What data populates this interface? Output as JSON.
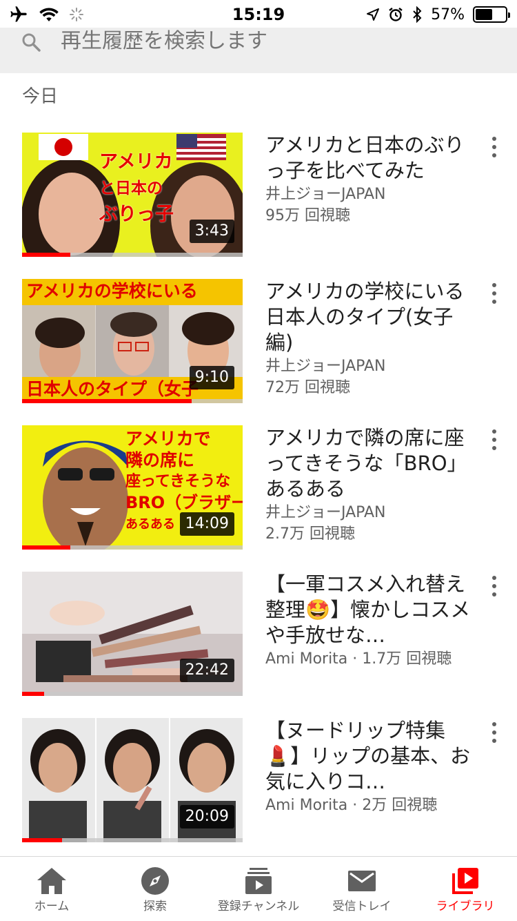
{
  "status_bar": {
    "time": "15:19",
    "battery": "57%",
    "battery_level": 0.57
  },
  "search": {
    "placeholder": "再生履歴を検索します"
  },
  "section": {
    "label": "今日"
  },
  "videos": [
    {
      "title": "アメリカと日本のぶりっ子を比べてみた",
      "channel": "井上ジョーJAPAN",
      "views": "95万 回視聴",
      "duration": "3:43",
      "progress": 0.22,
      "thumb_text": [
        "アメリカ",
        "と日本の",
        "ぶりっ子"
      ]
    },
    {
      "title": "アメリカの学校にいる日本人のタイプ(女子編)",
      "channel": "井上ジョーJAPAN",
      "views": "72万 回視聴",
      "duration": "9:10",
      "progress": 0.77,
      "thumb_text": [
        "アメリカの学校にいる",
        "日本人のタイプ（女子"
      ]
    },
    {
      "title": "アメリカで隣の席に座ってきそうな「BRO」あるある",
      "channel": "井上ジョーJAPAN",
      "views": "2.7万 回視聴",
      "duration": "14:09",
      "progress": 0.22,
      "thumb_text": [
        "アメリカで",
        "隣の席に",
        "座ってきそうな",
        "BRO（ブラザー）",
        "あるある"
      ]
    },
    {
      "title": "【一軍コスメ入れ替え整理🤩】懐かしコスメや手放せな…",
      "subline": "Ami Morita · 1.7万 回視聴",
      "duration": "22:42",
      "progress": 0.1
    },
    {
      "title": "【ヌードリップ特集💄】リップの基本、お気に入りコ…",
      "subline": "Ami Morita · 2万 回視聴",
      "duration": "20:09",
      "progress": 0.18
    }
  ],
  "bottom_nav": [
    {
      "label": "ホーム",
      "icon": "home-icon"
    },
    {
      "label": "探索",
      "icon": "compass-icon"
    },
    {
      "label": "登録チャンネル",
      "icon": "subscriptions-icon"
    },
    {
      "label": "受信トレイ",
      "icon": "inbox-icon"
    },
    {
      "label": "ライブラリ",
      "icon": "library-icon",
      "active": true
    }
  ],
  "colors": {
    "accent": "#ff0000",
    "text_primary": "#202020",
    "text_secondary": "#606060",
    "search_bg": "#eeeeee"
  }
}
